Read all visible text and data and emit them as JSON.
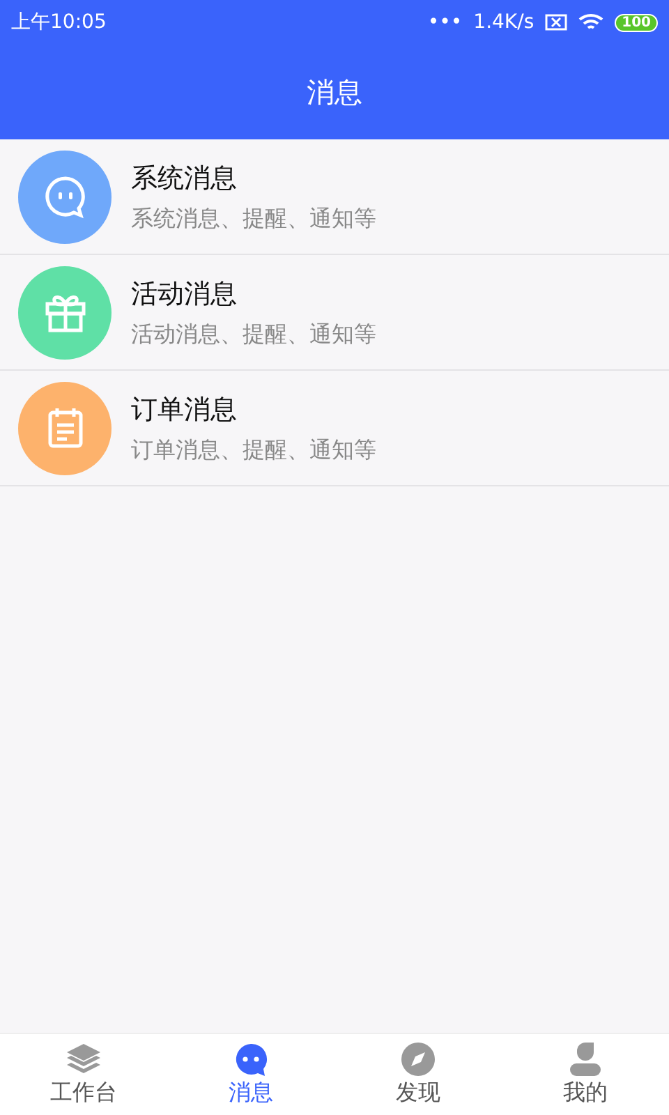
{
  "status_bar": {
    "time": "上午10:05",
    "more": "•••",
    "speed": "1.4K/s",
    "battery": "100"
  },
  "header": {
    "title": "消息"
  },
  "messages": [
    {
      "kind": "chat",
      "color": "#6fa8fa",
      "title": "系统消息",
      "subtitle": "系统消息、提醒、通知等"
    },
    {
      "kind": "gift",
      "color": "#5fe0a6",
      "title": "活动消息",
      "subtitle": "活动消息、提醒、通知等"
    },
    {
      "kind": "order",
      "color": "#fdb26c",
      "title": "订单消息",
      "subtitle": "订单消息、提醒、通知等"
    }
  ],
  "tabs": [
    {
      "kind": "layers",
      "label": "工作台",
      "selected": false
    },
    {
      "kind": "chat",
      "label": "消息",
      "selected": true
    },
    {
      "kind": "compass",
      "label": "发现",
      "selected": false
    },
    {
      "kind": "user",
      "label": "我的",
      "selected": false
    }
  ]
}
